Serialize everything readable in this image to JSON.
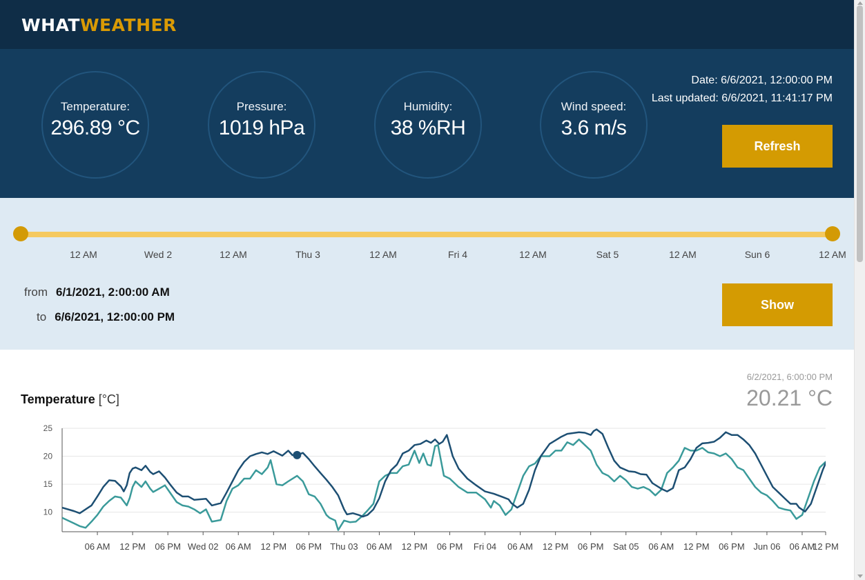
{
  "app": {
    "logo_part1": "WHAT",
    "logo_part2": "WEATHER"
  },
  "stats": [
    {
      "label": "Temperature:",
      "value": "296.89 °C"
    },
    {
      "label": "Pressure:",
      "value": "1019 hPa"
    },
    {
      "label": "Humidity:",
      "value": "38 %RH"
    },
    {
      "label": "Wind speed:",
      "value": "3.6 m/s"
    }
  ],
  "meta": {
    "date": "Date: 6/6/2021, 12:00:00 PM",
    "last_updated": "Last updated: 6/6/2021, 11:41:17 PM"
  },
  "buttons": {
    "refresh": "Refresh",
    "show": "Show"
  },
  "range": {
    "ticks": [
      "12 AM",
      "Wed 2",
      "12 AM",
      "Thu 3",
      "12 AM",
      "Fri 4",
      "12 AM",
      "Sat 5",
      "12 AM",
      "Sun 6",
      "12 AM"
    ],
    "from_label": "from",
    "from_value": "6/1/2021, 2:00:00 AM",
    "to_label": "to",
    "to_value": "6/6/2021, 12:00:00 PM",
    "slider_start": 0,
    "slider_end": 1
  },
  "colors": {
    "series_dark": "#1d4f73",
    "series_teal": "#3a9a9a",
    "accent": "#d49b02",
    "header": "#0f2d47",
    "panel": "#143d5e"
  },
  "readout": {
    "date": "6/2/2021, 6:00:00 PM",
    "value": "20.21 °C"
  },
  "chart_data": {
    "type": "line",
    "title": "Temperature",
    "unit": "[°C]",
    "ylim": [
      6.5,
      25
    ],
    "yticks": [
      10,
      15,
      20,
      25
    ],
    "xlim": [
      0,
      130
    ],
    "xtick_positions": [
      6,
      12,
      18,
      24,
      30,
      36,
      42,
      48,
      54,
      60,
      66,
      72,
      78,
      84,
      90,
      96,
      102,
      108,
      114,
      120,
      126,
      130
    ],
    "xtick_labels": [
      "06 AM",
      "12 PM",
      "06 PM",
      "Wed 02",
      "06 AM",
      "12 PM",
      "06 PM",
      "Thu 03",
      "06 AM",
      "12 PM",
      "06 PM",
      "Fri 04",
      "06 AM",
      "12 PM",
      "06 PM",
      "Sat 05",
      "06 AM",
      "12 PM",
      "06 PM",
      "Jun 06",
      "06 AM",
      "12 PM"
    ],
    "grid": true,
    "highlight": {
      "x": 40,
      "y": 20.21
    },
    "series": [
      {
        "values": [
          [
            0,
            10.8
          ],
          [
            2,
            10.2
          ],
          [
            3,
            9.8
          ],
          [
            5,
            11.2
          ],
          [
            6,
            12.8
          ],
          [
            7,
            14.5
          ],
          [
            8,
            15.7
          ],
          [
            9,
            15.6
          ],
          [
            10,
            14.6
          ],
          [
            10.5,
            13.7
          ],
          [
            11,
            14.8
          ],
          [
            11.5,
            17
          ],
          [
            12,
            17.8
          ],
          [
            12.5,
            18
          ],
          [
            13.5,
            17.5
          ],
          [
            14.2,
            18.3
          ],
          [
            15,
            17.2
          ],
          [
            15.5,
            16.8
          ],
          [
            16.5,
            17.3
          ],
          [
            17.5,
            16.2
          ],
          [
            18.5,
            14.8
          ],
          [
            19.5,
            13.5
          ],
          [
            20.5,
            12.8
          ],
          [
            21.5,
            12.8
          ],
          [
            22.5,
            12.2
          ],
          [
            23.5,
            12.3
          ],
          [
            24.5,
            12.4
          ],
          [
            25.5,
            11.2
          ],
          [
            27,
            11.6
          ],
          [
            28,
            13.5
          ],
          [
            29,
            15.5
          ],
          [
            30,
            17.5
          ],
          [
            31,
            19
          ],
          [
            32,
            20
          ],
          [
            33,
            20.4
          ],
          [
            34,
            20.7
          ],
          [
            35,
            20.4
          ],
          [
            36,
            20.9
          ],
          [
            37.5,
            20.1
          ],
          [
            38.5,
            21
          ],
          [
            39.2,
            20.2
          ],
          [
            40,
            20.21
          ],
          [
            41,
            20.6
          ],
          [
            42,
            19.5
          ],
          [
            43,
            18.2
          ],
          [
            44,
            17
          ],
          [
            45,
            15.8
          ],
          [
            46,
            14.5
          ],
          [
            47,
            13
          ],
          [
            48,
            10.5
          ],
          [
            48.5,
            9.6
          ],
          [
            49.5,
            9.8
          ],
          [
            50.5,
            9.5
          ],
          [
            51.2,
            9.2
          ],
          [
            52,
            9.5
          ],
          [
            53,
            10.5
          ],
          [
            54,
            12.5
          ],
          [
            55,
            15.5
          ],
          [
            56,
            17.5
          ],
          [
            57,
            18.5
          ],
          [
            58,
            20.5
          ],
          [
            59,
            21
          ],
          [
            60,
            22
          ],
          [
            61,
            22.2
          ],
          [
            62,
            22.8
          ],
          [
            62.8,
            22.4
          ],
          [
            63.5,
            23
          ],
          [
            64.2,
            22.2
          ],
          [
            64.8,
            22.6
          ],
          [
            65.5,
            23.8
          ],
          [
            66.5,
            20
          ],
          [
            67.5,
            17.8
          ],
          [
            69,
            16
          ],
          [
            70.5,
            14.8
          ],
          [
            72,
            13.7
          ],
          [
            73.5,
            13.3
          ],
          [
            75,
            12.7
          ],
          [
            76,
            12.3
          ],
          [
            76.5,
            11.6
          ],
          [
            77.5,
            10.8
          ],
          [
            78.5,
            11.5
          ],
          [
            79.5,
            14
          ],
          [
            80.5,
            17.5
          ],
          [
            81.5,
            20
          ],
          [
            83,
            22.2
          ],
          [
            85,
            23.5
          ],
          [
            86,
            24
          ],
          [
            88,
            24.3
          ],
          [
            89,
            24.2
          ],
          [
            90,
            23.8
          ],
          [
            90.5,
            24.5
          ],
          [
            91,
            24.8
          ],
          [
            92,
            24
          ],
          [
            93,
            21.5
          ],
          [
            94,
            19.2
          ],
          [
            95,
            18
          ],
          [
            96.5,
            17.3
          ],
          [
            97.5,
            17.2
          ],
          [
            98.5,
            16.8
          ],
          [
            99.5,
            16.7
          ],
          [
            100.5,
            15.2
          ],
          [
            102,
            14.2
          ],
          [
            103,
            13.7
          ],
          [
            104,
            14.3
          ],
          [
            105,
            17.5
          ],
          [
            106,
            18
          ],
          [
            107,
            19.5
          ],
          [
            108,
            21.5
          ],
          [
            109,
            22.3
          ],
          [
            110,
            22.4
          ],
          [
            111,
            22.6
          ],
          [
            112,
            23.3
          ],
          [
            113,
            24.3
          ],
          [
            114,
            23.8
          ],
          [
            115,
            23.8
          ],
          [
            116,
            23
          ],
          [
            117,
            22
          ],
          [
            118,
            20.5
          ],
          [
            119,
            18.5
          ],
          [
            120,
            16.5
          ],
          [
            121,
            14.5
          ],
          [
            122,
            13.5
          ],
          [
            123,
            12.5
          ],
          [
            124,
            11.5
          ],
          [
            125,
            11.5
          ],
          [
            125.5,
            10.8
          ],
          [
            126.5,
            10.1
          ],
          [
            127.5,
            11.5
          ],
          [
            128.5,
            14.5
          ],
          [
            129.5,
            17.5
          ],
          [
            130.5,
            20
          ],
          [
            131.5,
            21.5
          ],
          [
            132.5,
            22.6
          ],
          [
            133.5,
            23.3
          ],
          [
            134.5,
            23.5
          ]
        ]
      },
      {
        "values": [
          [
            0,
            9
          ],
          [
            2,
            8
          ],
          [
            3,
            7.5
          ],
          [
            4,
            7.2
          ],
          [
            5,
            8.3
          ],
          [
            6,
            9.5
          ],
          [
            7,
            11
          ],
          [
            8,
            12
          ],
          [
            9,
            12.8
          ],
          [
            10,
            12.6
          ],
          [
            11,
            11.2
          ],
          [
            11.5,
            12.5
          ],
          [
            12,
            14.5
          ],
          [
            12.5,
            15.5
          ],
          [
            13.5,
            14.5
          ],
          [
            14.2,
            15.5
          ],
          [
            15,
            14.2
          ],
          [
            15.5,
            13.6
          ],
          [
            16.5,
            14.2
          ],
          [
            17.5,
            14.8
          ],
          [
            18.5,
            13.3
          ],
          [
            19.5,
            11.8
          ],
          [
            20.5,
            11.2
          ],
          [
            21.5,
            11
          ],
          [
            22.5,
            10.5
          ],
          [
            23.5,
            9.8
          ],
          [
            24.5,
            10.5
          ],
          [
            25.5,
            8.3
          ],
          [
            27,
            8.6
          ],
          [
            28,
            12
          ],
          [
            29,
            14.2
          ],
          [
            30,
            14.8
          ],
          [
            31,
            16
          ],
          [
            32,
            16
          ],
          [
            33,
            17.5
          ],
          [
            34,
            16.8
          ],
          [
            35,
            18
          ],
          [
            35.5,
            19.3
          ],
          [
            36.5,
            15
          ],
          [
            37.5,
            14.8
          ],
          [
            38.5,
            15.5
          ],
          [
            40,
            16.5
          ],
          [
            41,
            15.5
          ],
          [
            42,
            13.2
          ],
          [
            43,
            12.8
          ],
          [
            44,
            11.5
          ],
          [
            45,
            9.5
          ],
          [
            45.5,
            9
          ],
          [
            46.5,
            8.5
          ],
          [
            47,
            6.8
          ],
          [
            48,
            8.5
          ],
          [
            49,
            8.2
          ],
          [
            50,
            8.3
          ],
          [
            51,
            9.2
          ],
          [
            52,
            10.3
          ],
          [
            53,
            11.5
          ],
          [
            54,
            15.5
          ],
          [
            55,
            16.5
          ],
          [
            56,
            17
          ],
          [
            57,
            17
          ],
          [
            58,
            18.2
          ],
          [
            59,
            18.5
          ],
          [
            60,
            21
          ],
          [
            60.8,
            18.8
          ],
          [
            61.5,
            20.5
          ],
          [
            62.2,
            18.5
          ],
          [
            62.8,
            18.3
          ],
          [
            63.5,
            21.8
          ],
          [
            64,
            22
          ],
          [
            65,
            16.5
          ],
          [
            66,
            16
          ],
          [
            67.5,
            14.5
          ],
          [
            69,
            13.5
          ],
          [
            70.5,
            13.5
          ],
          [
            72,
            12.3
          ],
          [
            73,
            10.8
          ],
          [
            73.5,
            12
          ],
          [
            74.5,
            11.2
          ],
          [
            75.5,
            9.5
          ],
          [
            76.5,
            10.5
          ],
          [
            77.5,
            13.5
          ],
          [
            78.5,
            16.5
          ],
          [
            79.5,
            18.2
          ],
          [
            80.5,
            18.7
          ],
          [
            81.5,
            20
          ],
          [
            83,
            20
          ],
          [
            84,
            21
          ],
          [
            85,
            21
          ],
          [
            86,
            22.5
          ],
          [
            87,
            22
          ],
          [
            88,
            23
          ],
          [
            89,
            22
          ],
          [
            90,
            21
          ],
          [
            91,
            18.5
          ],
          [
            92,
            17
          ],
          [
            93,
            16.5
          ],
          [
            94,
            15.5
          ],
          [
            95,
            16.5
          ],
          [
            96,
            15.7
          ],
          [
            97,
            14.5
          ],
          [
            98,
            14.2
          ],
          [
            99,
            14.5
          ],
          [
            100,
            14
          ],
          [
            101,
            13
          ],
          [
            102,
            14
          ],
          [
            103,
            17
          ],
          [
            104,
            18
          ],
          [
            105,
            19.2
          ],
          [
            106,
            21.5
          ],
          [
            107,
            21
          ],
          [
            108,
            21
          ],
          [
            109,
            21.5
          ],
          [
            110,
            20.7
          ],
          [
            111,
            20.5
          ],
          [
            112,
            20
          ],
          [
            113,
            20.5
          ],
          [
            114,
            19.5
          ],
          [
            115,
            18
          ],
          [
            116,
            17.5
          ],
          [
            117,
            16
          ],
          [
            118,
            14.5
          ],
          [
            119,
            13.5
          ],
          [
            120,
            13
          ],
          [
            121,
            12
          ],
          [
            122,
            10.8
          ],
          [
            123,
            10.5
          ],
          [
            124,
            10.3
          ],
          [
            125,
            8.8
          ],
          [
            126,
            9.5
          ],
          [
            127,
            12.5
          ],
          [
            128,
            15.5
          ],
          [
            129,
            18
          ],
          [
            130,
            19
          ],
          [
            131,
            19
          ],
          [
            132,
            20
          ],
          [
            133,
            20.7
          ],
          [
            134,
            20.8
          ]
        ]
      }
    ]
  }
}
